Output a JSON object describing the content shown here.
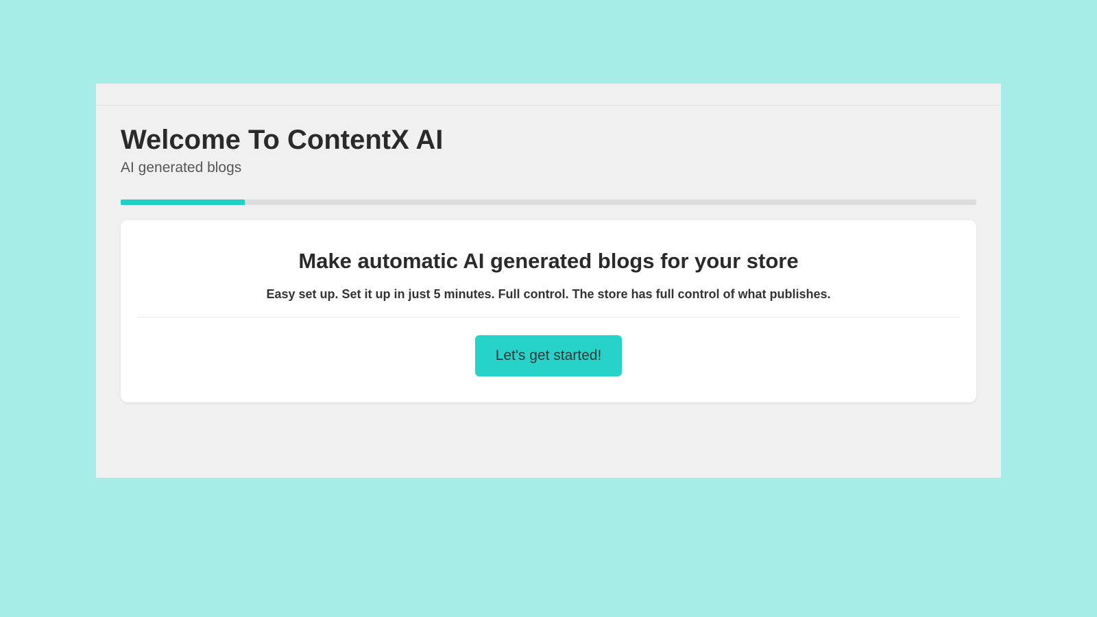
{
  "header": {
    "title": "Welcome To ContentX AI",
    "subtitle": "AI generated blogs"
  },
  "progress": {
    "percent": 14.5
  },
  "card": {
    "title": "Make automatic AI generated blogs for your store",
    "subtitle": "Easy set up. Set it up in just 5 minutes. Full control. The store has full control of what publishes.",
    "cta_label": "Let's get started!"
  },
  "colors": {
    "background": "#a7ede7",
    "panel": "#f0f0f0",
    "accent": "#1fd1c7",
    "button": "#27d3c9"
  }
}
